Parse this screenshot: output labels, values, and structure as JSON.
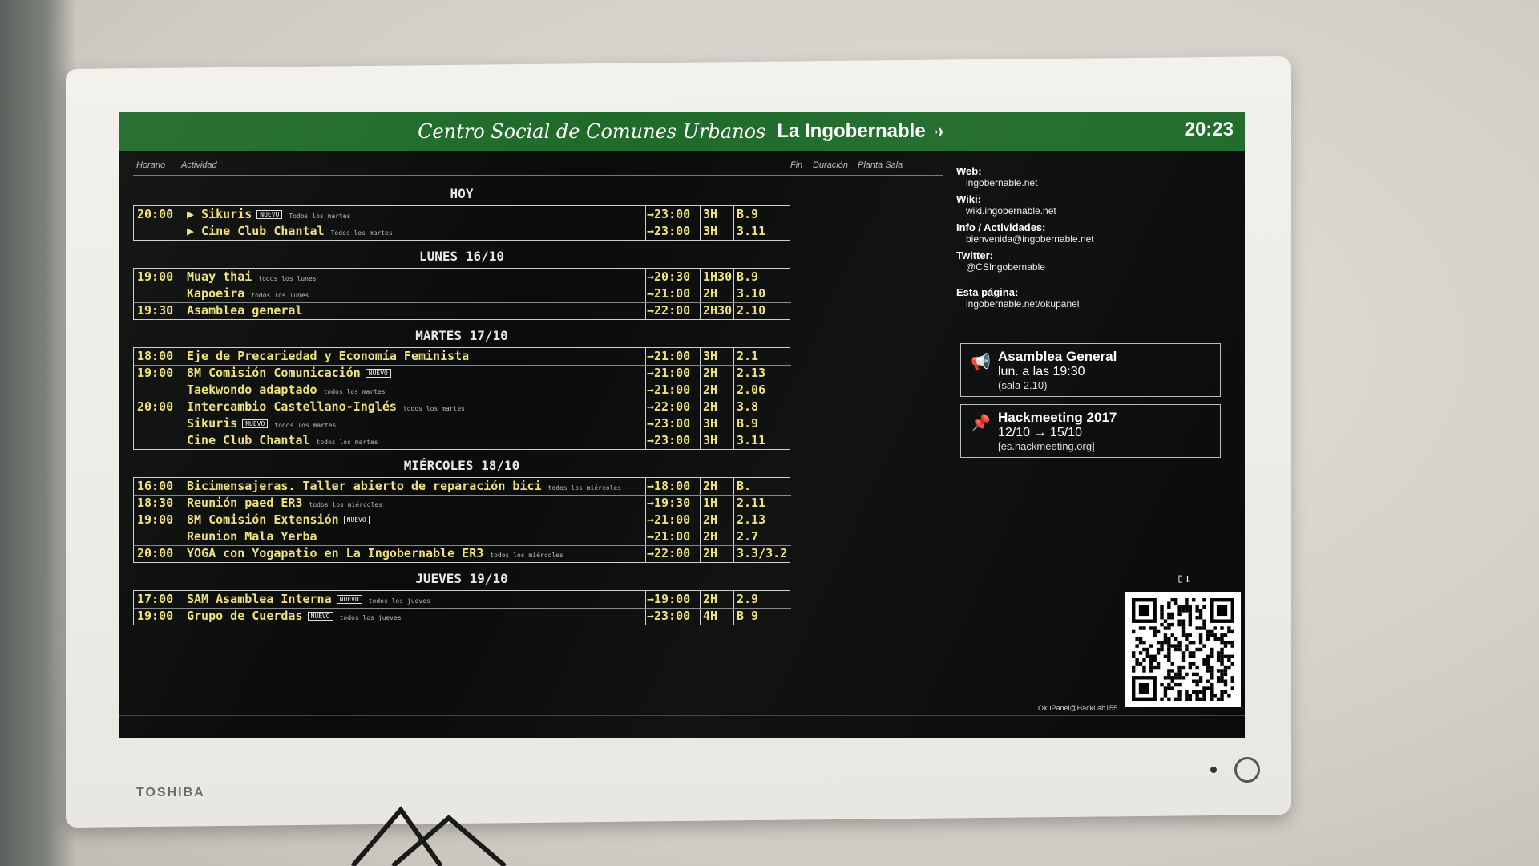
{
  "header": {
    "title_script": "Centro Social de Comunes Urbanos",
    "title_bold": "La Ingobernable",
    "clock": "20:23"
  },
  "columns": {
    "horario": "Horario",
    "actividad": "Actividad",
    "fin": "Fin",
    "duracion": "Duración",
    "planta_sala": "Planta Sala"
  },
  "days": [
    {
      "title": "HOY",
      "rows": [
        {
          "time": "20:00",
          "activity": "▶ Sikuris",
          "badge": "NUEVO",
          "note": "Todos los martes",
          "fin": "→23:00",
          "dur": "3H",
          "sala": "B.9"
        },
        {
          "time": "",
          "activity": "▶ Cine Club Chantal",
          "badge": "",
          "note": "Todos los martes",
          "fin": "→23:00",
          "dur": "3H",
          "sala": "3.11"
        }
      ]
    },
    {
      "title": "LUNES 16/10",
      "rows": [
        {
          "time": "19:00",
          "activity": "Muay thai",
          "badge": "",
          "note": "todos los lunes",
          "fin": "→20:30",
          "dur": "1H30",
          "sala": "B.9"
        },
        {
          "time": "",
          "activity": "Kapoeira",
          "badge": "",
          "note": "todos los lunes",
          "fin": "→21:00",
          "dur": "2H",
          "sala": "3.10"
        },
        {
          "time": "19:30",
          "activity": "Asamblea general",
          "badge": "",
          "note": "",
          "fin": "→22:00",
          "dur": "2H30",
          "sala": "2.10"
        }
      ]
    },
    {
      "title": "MARTES 17/10",
      "rows": [
        {
          "time": "18:00",
          "activity": "Eje de Precariedad y Economía Feminista",
          "badge": "",
          "note": "",
          "fin": "→21:00",
          "dur": "3H",
          "sala": "2.1"
        },
        {
          "time": "19:00",
          "activity": "8M Comisión Comunicación",
          "badge": "NUEVO",
          "note": "",
          "fin": "→21:00",
          "dur": "2H",
          "sala": "2.13"
        },
        {
          "time": "",
          "activity": "Taekwondo adaptado",
          "badge": "",
          "note": "todos los martes",
          "fin": "→21:00",
          "dur": "2H",
          "sala": "2.06"
        },
        {
          "time": "20:00",
          "activity": "Intercambio Castellano-Inglés",
          "badge": "",
          "note": "todos los martes",
          "fin": "→22:00",
          "dur": "2H",
          "sala": "3.8"
        },
        {
          "time": "",
          "activity": "Sikuris",
          "badge": "NUEVO",
          "note": "todos los martes",
          "fin": "→23:00",
          "dur": "3H",
          "sala": "B.9"
        },
        {
          "time": "",
          "activity": "Cine Club Chantal",
          "badge": "",
          "note": "todos los martes",
          "fin": "→23:00",
          "dur": "3H",
          "sala": "3.11"
        }
      ]
    },
    {
      "title": "MIÉRCOLES 18/10",
      "rows": [
        {
          "time": "16:00",
          "activity": "Bicimensajeras. Taller abierto de reparación bici",
          "badge": "",
          "note": "todos los miércoles",
          "fin": "→18:00",
          "dur": "2H",
          "sala": "B."
        },
        {
          "time": "18:30",
          "activity": "Reunión paed ER3",
          "badge": "",
          "note": "todos los miércoles",
          "fin": "→19:30",
          "dur": "1H",
          "sala": "2.11"
        },
        {
          "time": "19:00",
          "activity": "8M Comisión Extensión",
          "badge": "NUEVO",
          "note": "",
          "fin": "→21:00",
          "dur": "2H",
          "sala": "2.13"
        },
        {
          "time": "",
          "activity": "Reunion Mala Yerba",
          "badge": "",
          "note": "",
          "fin": "→21:00",
          "dur": "2H",
          "sala": "2.7"
        },
        {
          "time": "20:00",
          "activity": "YOGA con Yogapatio en La Ingobernable ER3",
          "badge": "",
          "note": "todos los miércoles",
          "fin": "→22:00",
          "dur": "2H",
          "sala": "3.3/3.2"
        }
      ]
    },
    {
      "title": "JUEVES 19/10",
      "rows": [
        {
          "time": "17:00",
          "activity": "SAM Asamblea Interna",
          "badge": "NUEVO",
          "note": "todos los jueves",
          "fin": "→19:00",
          "dur": "2H",
          "sala": "2.9"
        },
        {
          "time": "19:00",
          "activity": "Grupo de Cuerdas",
          "badge": "NUEVO",
          "note": "todos los jueves",
          "fin": "→23:00",
          "dur": "4H",
          "sala": "B 9"
        }
      ]
    }
  ],
  "sidebar": {
    "web_label": "Web:",
    "web_value": "ingobernable.net",
    "wiki_label": "Wiki:",
    "wiki_value": "wiki.ingobernable.net",
    "info_label": "Info / Actividades:",
    "info_value": "bienvenida@ingobernable.net",
    "twitter_label": "Twitter:",
    "twitter_value": "@CSIngobernable",
    "page_label": "Esta página:",
    "page_value": "ingobernable.net/okupanel"
  },
  "cards": [
    {
      "icon": "megaphone-icon",
      "title": "Asamblea General",
      "subtitle": "lun. a las 19:30",
      "extra": "(sala 2.10)"
    },
    {
      "icon": "pin-icon",
      "title": "Hackmeeting 2017",
      "subtitle": "12/10 → 15/10",
      "extra": "[es.hackmeeting.org]"
    }
  ],
  "qr_label": "▯↓",
  "credit": "OkuPanel@HackLab155",
  "brand": "TOSHIBA"
}
